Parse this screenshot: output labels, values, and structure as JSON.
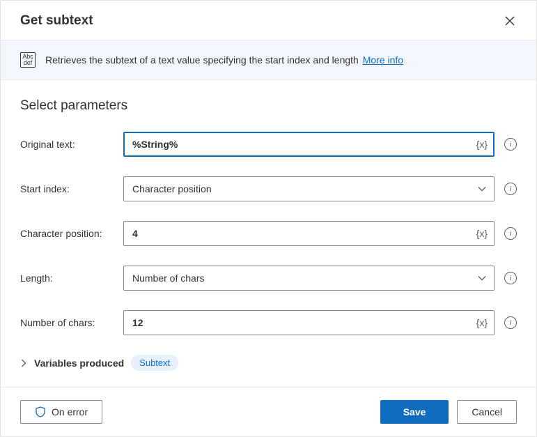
{
  "header": {
    "title": "Get subtext"
  },
  "banner": {
    "icon_text_top": "Abc",
    "icon_text_bot": "def",
    "text": "Retrieves the subtext of a text value specifying the start index and length",
    "more_info": "More info"
  },
  "section_title": "Select parameters",
  "fields": {
    "original_text": {
      "label": "Original text:",
      "value": "%String%"
    },
    "start_index": {
      "label": "Start index:",
      "value": "Character position"
    },
    "char_pos": {
      "label": "Character position:",
      "value": "4"
    },
    "length": {
      "label": "Length:",
      "value": "Number of chars"
    },
    "num_chars": {
      "label": "Number of chars:",
      "value": "12"
    }
  },
  "var_token_glyph": "{x}",
  "vars_produced": {
    "label": "Variables produced",
    "chip": "Subtext"
  },
  "footer": {
    "on_error": "On error",
    "save": "Save",
    "cancel": "Cancel"
  }
}
